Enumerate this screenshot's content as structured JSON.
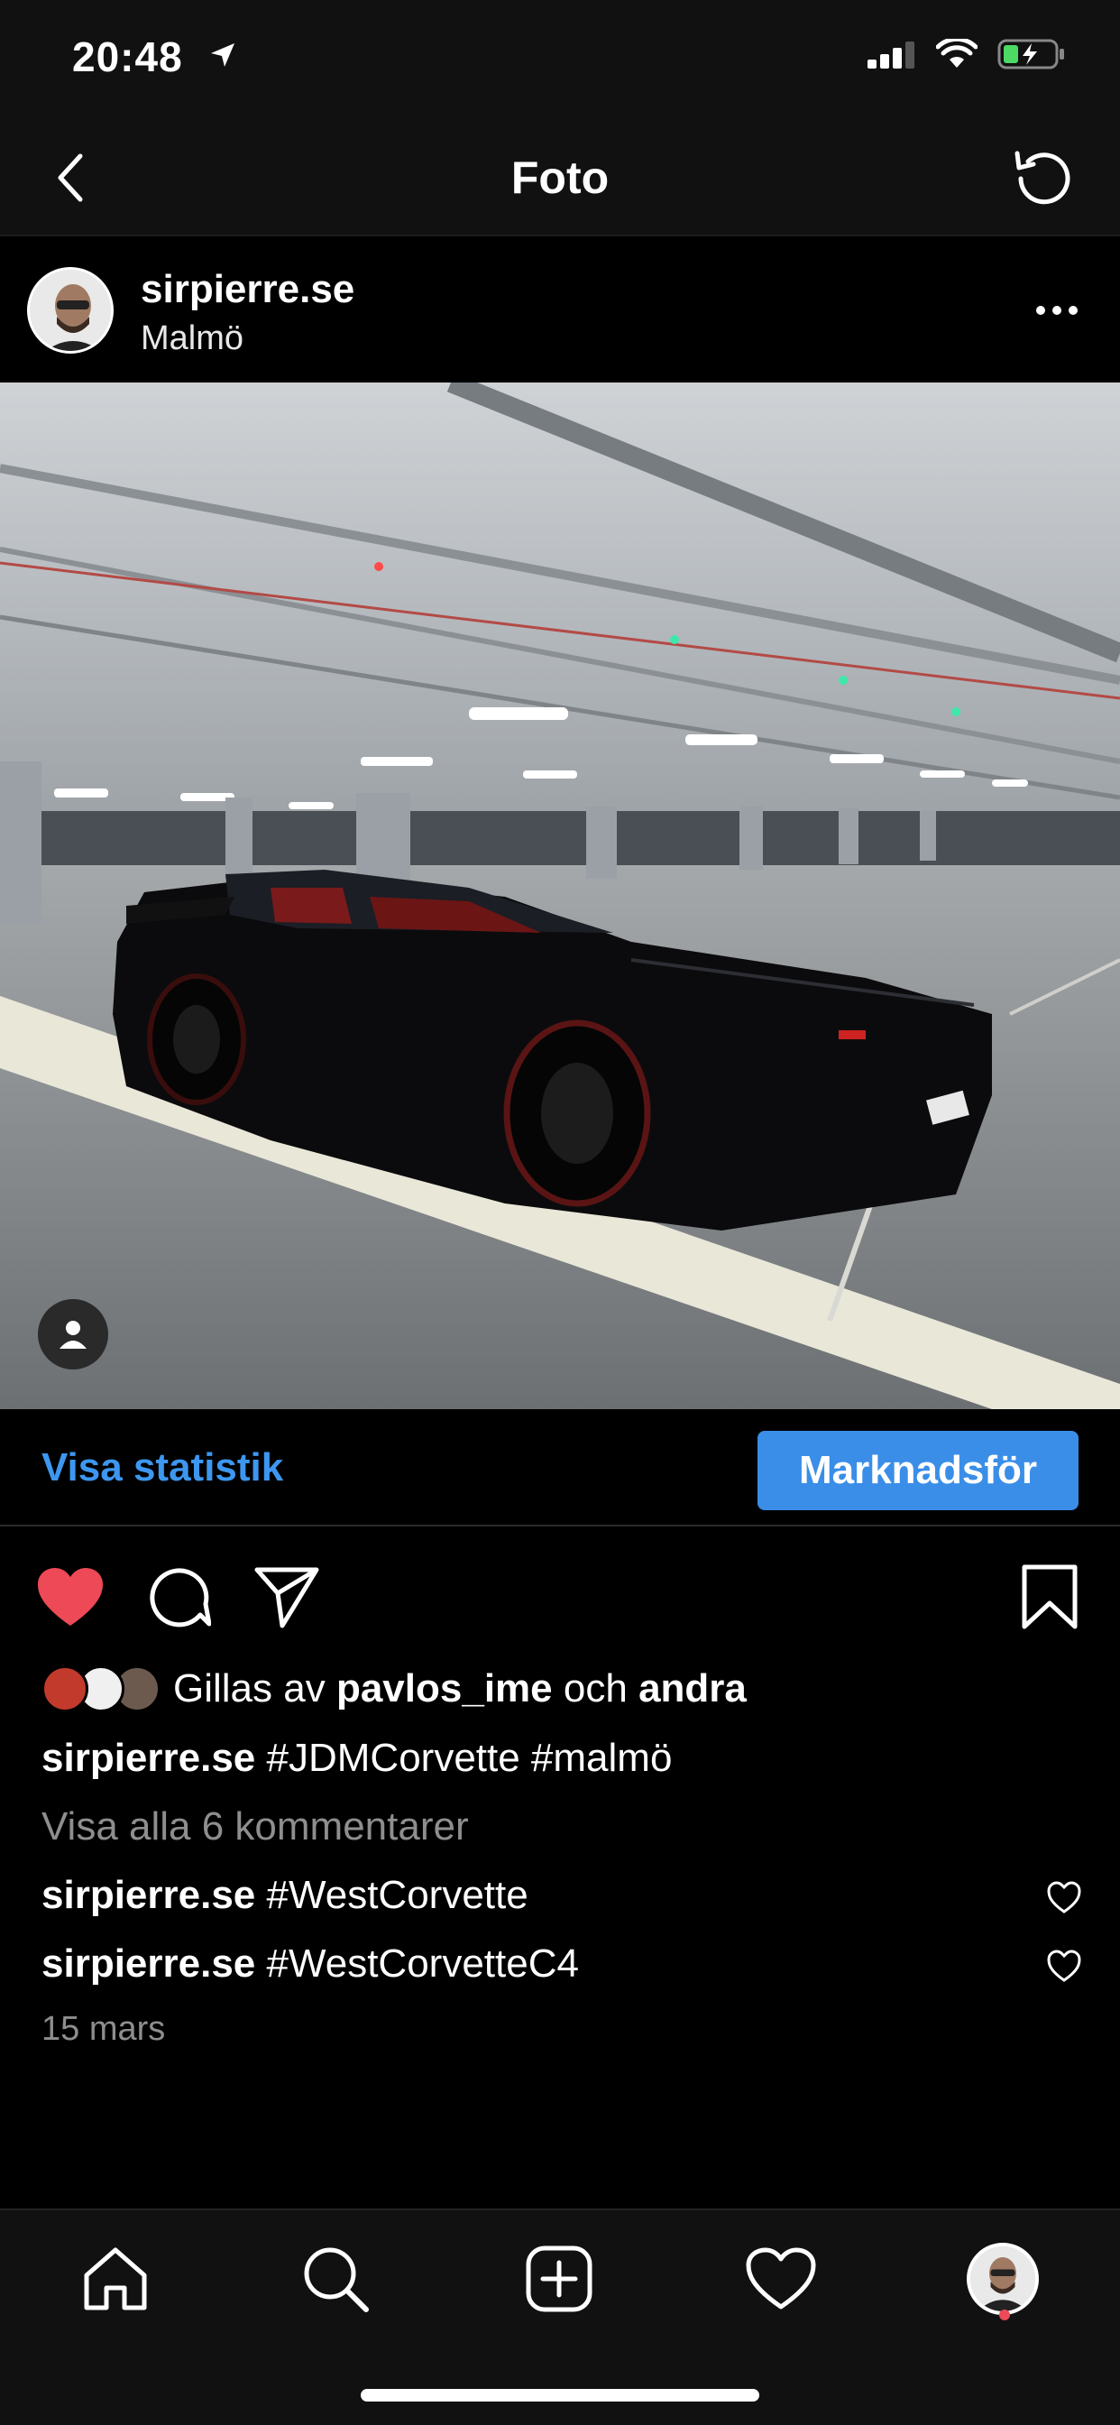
{
  "status_bar": {
    "time": "20:48"
  },
  "nav": {
    "title": "Foto"
  },
  "post": {
    "username": "sirpierre.se",
    "location": "Malmö"
  },
  "stats": {
    "view_insights": "Visa statistik",
    "promote": "Marknadsför"
  },
  "likes": {
    "prefix": "Gillas av",
    "user": "pavlos_ime",
    "connector": "och",
    "others": "andra"
  },
  "caption": {
    "username": "sirpierre.se",
    "text": "#JDMCorvette #malmö"
  },
  "view_comments": "Visa alla 6 kommentarer",
  "comments": [
    {
      "username": "sirpierre.se",
      "text": "#WestCorvette"
    },
    {
      "username": "sirpierre.se",
      "text": "#WestCorvetteC4"
    }
  ],
  "date": "15 mars",
  "colors": {
    "accent": "#3d97f0",
    "like": "#ed4956",
    "background": "#000000"
  },
  "tabs": [
    "home-icon",
    "search-icon",
    "new-post-icon",
    "activity-icon",
    "profile-avatar"
  ]
}
